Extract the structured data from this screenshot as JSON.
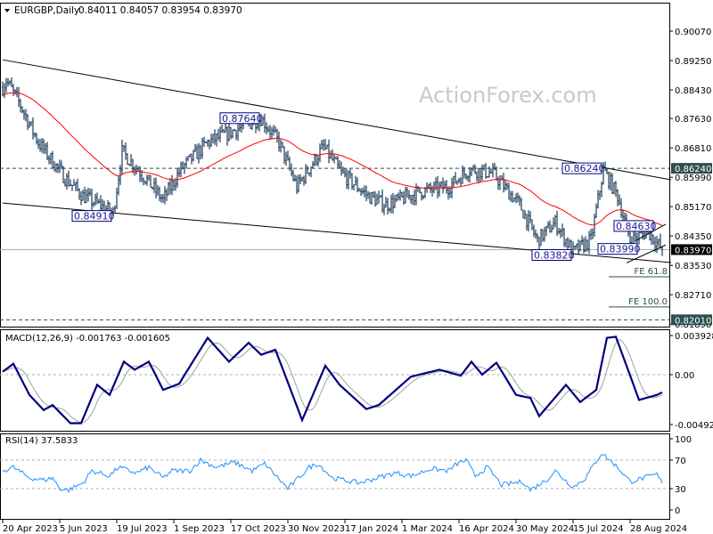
{
  "header": {
    "symbol": "EURGBP,Daily",
    "ohlc": "0.84011 0.84057 0.83954 0.83970"
  },
  "watermark": "ActionForex.com",
  "colors": {
    "bars": "#1e3d59",
    "ma": "#ff0000",
    "macd": "#000080",
    "signal": "#a0a0a0",
    "rsi": "#1e90ff",
    "trendline": "#000000",
    "label_box": "#000080"
  },
  "chart_data": [
    {
      "type": "ohlc",
      "title": "EURGBP,Daily",
      "ylim": [
        0.8185,
        0.903
      ],
      "y_ticks": [
        "0.90070",
        "0.89250",
        "0.88430",
        "0.87630",
        "0.86810",
        "0.85990",
        "0.85170",
        "0.84350",
        "0.83530",
        "0.82710",
        "0.81890"
      ],
      "x_ticks": [
        {
          "bar": 0,
          "label": "20 Apr 2023"
        },
        {
          "bar": 32,
          "label": "5 Jun 2023"
        },
        {
          "bar": 64,
          "label": "19 Jul 2023"
        },
        {
          "bar": 96,
          "label": "1 Sep 2023"
        },
        {
          "bar": 128,
          "label": "17 Oct 2023"
        },
        {
          "bar": 160,
          "label": "30 Nov 2023"
        },
        {
          "bar": 192,
          "label": "17 Jan 2024"
        },
        {
          "bar": 224,
          "label": "1 Mar 2024"
        },
        {
          "bar": 256,
          "label": "16 Apr 2024"
        },
        {
          "bar": 288,
          "label": "30 May 2024"
        },
        {
          "bar": 320,
          "label": "15 Jul 2024"
        },
        {
          "bar": 352,
          "label": "28 Aug 2024"
        }
      ],
      "bar_count": 371,
      "price_path": [
        [
          0,
          0.885
        ],
        [
          2,
          0.887
        ],
        [
          10,
          0.88
        ],
        [
          20,
          0.8696
        ],
        [
          35,
          0.8597
        ],
        [
          45,
          0.8547
        ],
        [
          62,
          0.85
        ],
        [
          67,
          0.8671
        ],
        [
          80,
          0.8597
        ],
        [
          90,
          0.8535
        ],
        [
          100,
          0.8622
        ],
        [
          115,
          0.8696
        ],
        [
          130,
          0.873
        ],
        [
          145,
          0.8764
        ],
        [
          155,
          0.8696
        ],
        [
          165,
          0.8572
        ],
        [
          180,
          0.8684
        ],
        [
          190,
          0.861
        ],
        [
          205,
          0.8547
        ],
        [
          215,
          0.8522
        ],
        [
          235,
          0.856
        ],
        [
          250,
          0.8572
        ],
        [
          262,
          0.8622
        ],
        [
          275,
          0.861
        ],
        [
          290,
          0.8522
        ],
        [
          300,
          0.8423
        ],
        [
          310,
          0.8473
        ],
        [
          320,
          0.839
        ],
        [
          330,
          0.8423
        ],
        [
          337,
          0.862
        ],
        [
          345,
          0.8547
        ],
        [
          352,
          0.8423
        ],
        [
          362,
          0.8448
        ],
        [
          370,
          0.8397
        ]
      ],
      "last_price": {
        "value": 0.8397,
        "label": "0.83970"
      },
      "horizontal_levels": [
        {
          "value": 0.8624,
          "label": "0.86240",
          "style": "dashed"
        },
        {
          "value": 0.8201,
          "label": "0.82010",
          "style": "dashed"
        }
      ],
      "trendlines": [
        {
          "from": [
            0,
            0.8927
          ],
          "to": [
            375,
            0.8592
          ]
        },
        {
          "from": [
            0,
            0.8527
          ],
          "to": [
            375,
            0.8361
          ]
        },
        {
          "from": [
            355,
            0.8422
          ],
          "to": [
            372,
            0.8468
          ]
        },
        {
          "from": [
            350,
            0.836
          ],
          "to": [
            372,
            0.841
          ]
        }
      ],
      "annotations": [
        {
          "bar": 145,
          "price": 0.8764,
          "label": "0.87640"
        },
        {
          "bar": 62,
          "price": 0.8491,
          "label": "0.84910"
        },
        {
          "bar": 337,
          "price": 0.8624,
          "label": "0.86240"
        },
        {
          "bar": 352,
          "price": 0.8463,
          "label": "0.84630"
        },
        {
          "bar": 343,
          "price": 0.8399,
          "label": "0.83990"
        },
        {
          "bar": 320,
          "price": 0.8382,
          "label": "0.83820"
        }
      ],
      "fib_levels": [
        {
          "from_bar": 340,
          "value": 0.8321,
          "label": "FE 61.8"
        },
        {
          "from_bar": 340,
          "value": 0.8237,
          "label": "FE 100.0"
        }
      ]
    },
    {
      "type": "line",
      "title": "MACD(12,26,9) -0.001763 -0.001605",
      "ylim": [
        -0.005,
        0.0041
      ],
      "y_ticks": [
        {
          "value": 0.003928,
          "label": "0.003928"
        },
        {
          "value": 0,
          "label": "0.00"
        },
        {
          "value": -0.004929,
          "label": "-0.004929"
        }
      ],
      "macd_path": [
        [
          0,
          0.0003
        ],
        [
          6,
          0.0011
        ],
        [
          15,
          -0.002
        ],
        [
          23,
          -0.0035
        ],
        [
          28,
          -0.003
        ],
        [
          38,
          -0.0048
        ],
        [
          44,
          -0.0048
        ],
        [
          53,
          -0.001
        ],
        [
          60,
          -0.002
        ],
        [
          68,
          0.0013
        ],
        [
          74,
          0.0005
        ],
        [
          82,
          0.0013
        ],
        [
          90,
          -0.0015
        ],
        [
          99,
          -0.0009
        ],
        [
          115,
          0.0037
        ],
        [
          127,
          0.0013
        ],
        [
          138,
          0.0032
        ],
        [
          145,
          0.002
        ],
        [
          153,
          0.0025
        ],
        [
          168,
          -0.0045
        ],
        [
          181,
          0.0009
        ],
        [
          189,
          -0.001
        ],
        [
          204,
          -0.0034
        ],
        [
          211,
          -0.003
        ],
        [
          229,
          -0.0002
        ],
        [
          245,
          0.0005
        ],
        [
          257,
          -0.0001
        ],
        [
          263,
          0.0013
        ],
        [
          269,
          0.0
        ],
        [
          277,
          0.0012
        ],
        [
          288,
          -0.002
        ],
        [
          296,
          -0.0023
        ],
        [
          301,
          -0.0041
        ],
        [
          316,
          -0.001
        ],
        [
          324,
          -0.0027
        ],
        [
          333,
          -0.0015
        ],
        [
          339,
          0.0037
        ],
        [
          344,
          0.0038
        ],
        [
          357,
          -0.0025
        ],
        [
          367,
          -0.002
        ],
        [
          370,
          -0.00176
        ]
      ]
    },
    {
      "type": "line",
      "title": "RSI(14) 37.5833",
      "ylim": [
        0,
        100
      ],
      "y_ticks": [
        "100",
        "70",
        "30",
        "0"
      ],
      "levels": [
        70,
        30
      ],
      "rsi_path": [
        [
          0,
          55
        ],
        [
          6,
          60
        ],
        [
          15,
          45
        ],
        [
          23,
          42
        ],
        [
          28,
          45
        ],
        [
          32,
          30
        ],
        [
          37,
          28
        ],
        [
          45,
          38
        ],
        [
          50,
          55
        ],
        [
          60,
          48
        ],
        [
          65,
          60
        ],
        [
          75,
          52
        ],
        [
          82,
          60
        ],
        [
          90,
          45
        ],
        [
          95,
          55
        ],
        [
          105,
          55
        ],
        [
          111,
          70
        ],
        [
          120,
          60
        ],
        [
          130,
          67
        ],
        [
          140,
          55
        ],
        [
          147,
          65
        ],
        [
          160,
          30
        ],
        [
          172,
          60
        ],
        [
          177,
          65
        ],
        [
          185,
          45
        ],
        [
          200,
          38
        ],
        [
          210,
          45
        ],
        [
          220,
          52
        ],
        [
          230,
          48
        ],
        [
          240,
          58
        ],
        [
          250,
          55
        ],
        [
          255,
          65
        ],
        [
          260,
          70
        ],
        [
          265,
          48
        ],
        [
          272,
          60
        ],
        [
          280,
          35
        ],
        [
          292,
          40
        ],
        [
          296,
          28
        ],
        [
          305,
          42
        ],
        [
          310,
          55
        ],
        [
          320,
          32
        ],
        [
          327,
          45
        ],
        [
          336,
          80
        ],
        [
          345,
          60
        ],
        [
          352,
          40
        ],
        [
          360,
          45
        ],
        [
          367,
          50
        ],
        [
          370,
          37.58
        ]
      ]
    }
  ]
}
